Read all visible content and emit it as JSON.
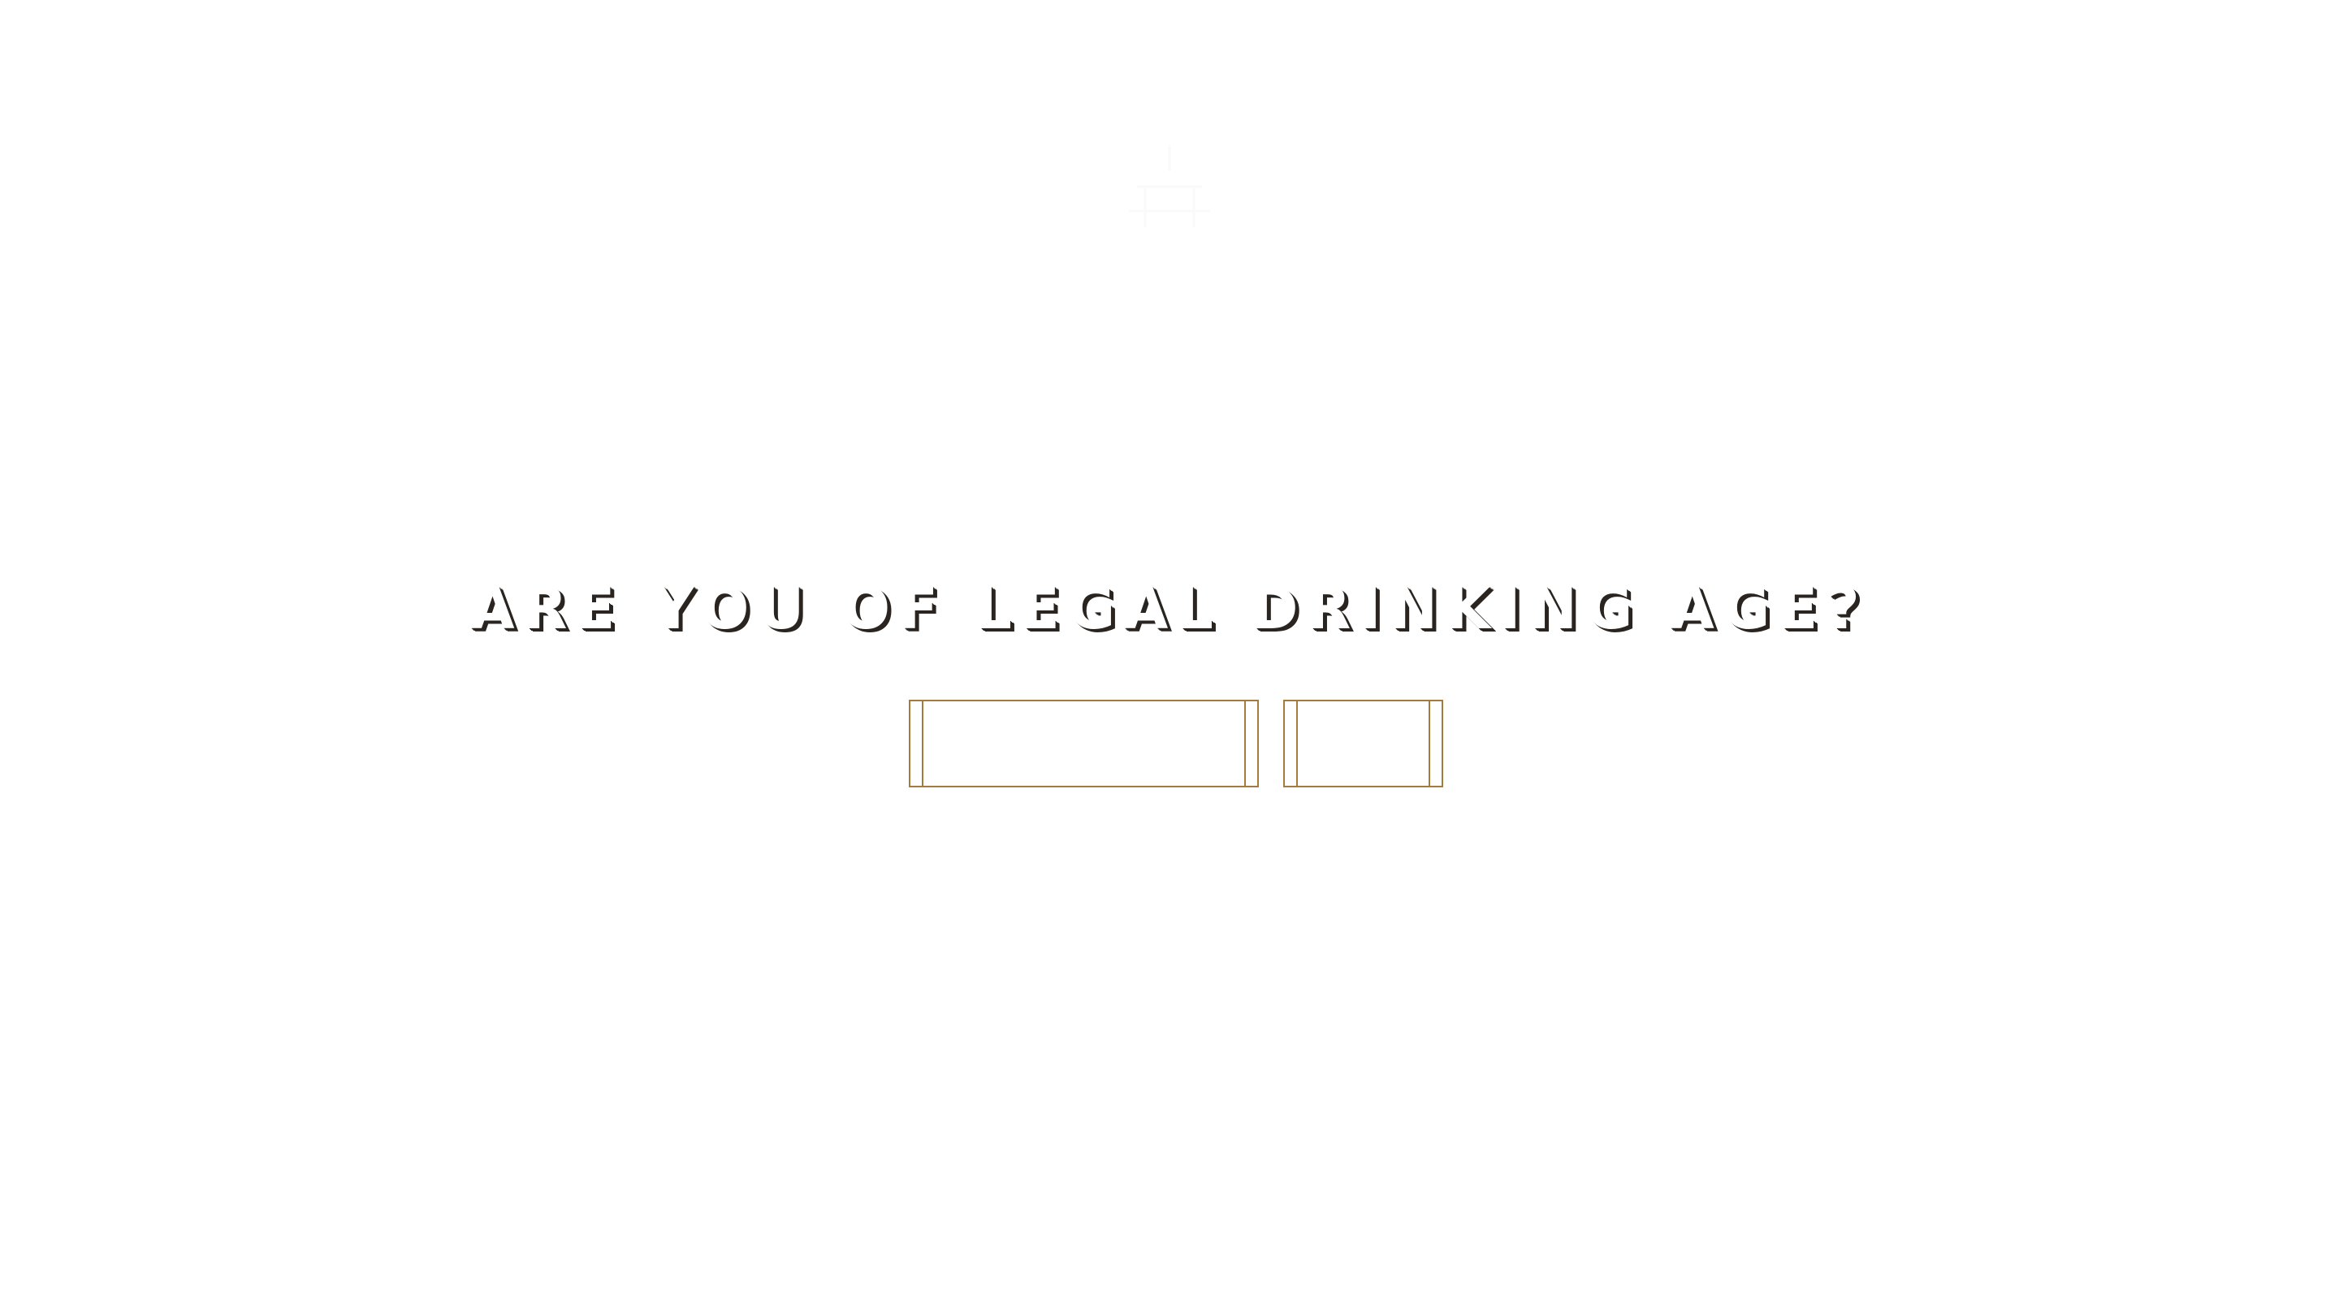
{
  "age_gate": {
    "question": "ARE YOU OF LEGAL DRINKING AGE?",
    "yes_label": "",
    "no_label": ""
  },
  "icons": {
    "logo": "brand-logo-icon"
  },
  "colors": {
    "background": "#ffffff",
    "accent_gold": "#a47b3a",
    "text_shadow": "#2a2520",
    "text_fill": "#ffffff"
  }
}
